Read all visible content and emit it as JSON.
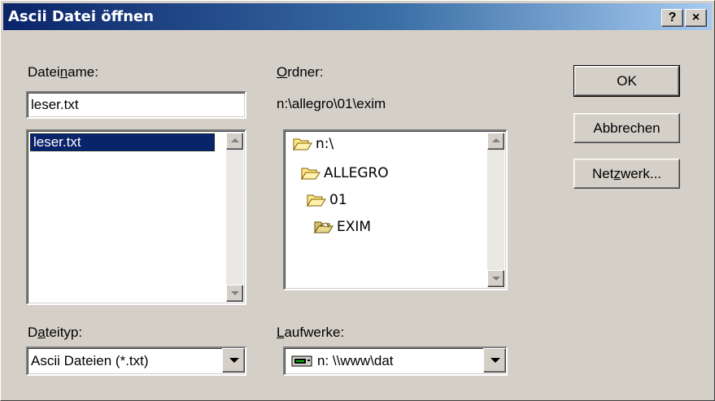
{
  "window": {
    "title": "Ascii Datei öffnen",
    "help_label": "?",
    "close_label": "×"
  },
  "filename": {
    "label_pre": "Datei",
    "label_accel": "n",
    "label_post": "ame:",
    "value": "leser.txt",
    "files": [
      "leser.txt"
    ]
  },
  "folder": {
    "label_accel": "O",
    "label_post": "rdner:",
    "path": "n:\\allegro\\01\\exim",
    "tree": [
      {
        "name": "n:\\",
        "icon": "open-folder-icon"
      },
      {
        "name": "ALLEGRO",
        "icon": "open-folder-icon"
      },
      {
        "name": "01",
        "icon": "open-folder-icon"
      },
      {
        "name": "EXIM",
        "icon": "open-folder-icon"
      }
    ]
  },
  "filetype": {
    "label_pre": "D",
    "label_accel": "a",
    "label_post": "teityp:",
    "value": "Ascii Dateien (*.txt)"
  },
  "drives": {
    "label_accel": "L",
    "label_post": "aufwerke:",
    "value": "n: \\\\www\\dat",
    "icon": "network-drive-icon"
  },
  "buttons": {
    "ok": "OK",
    "cancel": "Abbrechen",
    "network_pre": "Net",
    "network_accel": "z",
    "network_post": "werk..."
  }
}
